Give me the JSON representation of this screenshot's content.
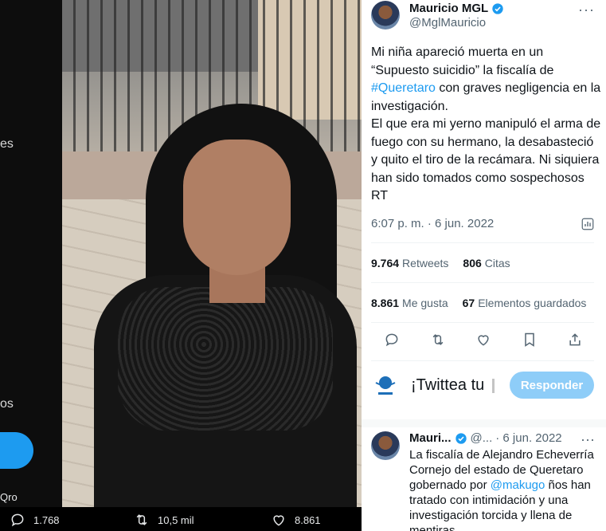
{
  "background_fragments": {
    "fragment_1": "es",
    "fragment_2": "os",
    "fragment_3": "Qro"
  },
  "media_bar": {
    "reply_count": "1.768",
    "retweet_count": "10,5 mil",
    "like_count": "8.861"
  },
  "tweet": {
    "author_name": "Mauricio MGL",
    "author_handle": "@MglMauricio",
    "more": "···",
    "text_part1": "Mi niña apareció muerta en un “Supuesto suicidio” la fiscalía de ",
    "hashtag": "#Queretaro",
    "text_part2": " con graves negligencia en la investigación.\nEl que era mi yerno manipuló el arma de fuego con su hermano, la desabasteció y quito el tiro de la recámara. Ni siquiera han sido tomados como sospechosos RT",
    "timestamp": "6:07 p. m. · 6 jun. 2022",
    "stats": {
      "retweets_value": "9.764",
      "retweets_label": "Retweets",
      "quotes_value": "806",
      "quotes_label": "Citas",
      "likes_value": "8.861",
      "likes_label": "Me gusta",
      "bookmarks_value": "67",
      "bookmarks_label": "Elementos guardados"
    }
  },
  "compose": {
    "placeholder": "¡Twittea tu",
    "reply_button": "Responder"
  },
  "reply": {
    "author_name": "Mauri...",
    "handle": "@...",
    "date": "· 6 jun. 2022",
    "more": "···",
    "text_part1": "La fiscalía de Alejandro Echeverría Cornejo del estado de Queretaro gobernado por ",
    "mention": "@makugo",
    "text_part2": " ños han tratado con intimidación y una investigación torcida y llena de mentiras"
  },
  "colors": {
    "accent": "#1d9bf0",
    "reply_button_disabled": "#8ecdf8",
    "secondary_text": "#536471"
  }
}
